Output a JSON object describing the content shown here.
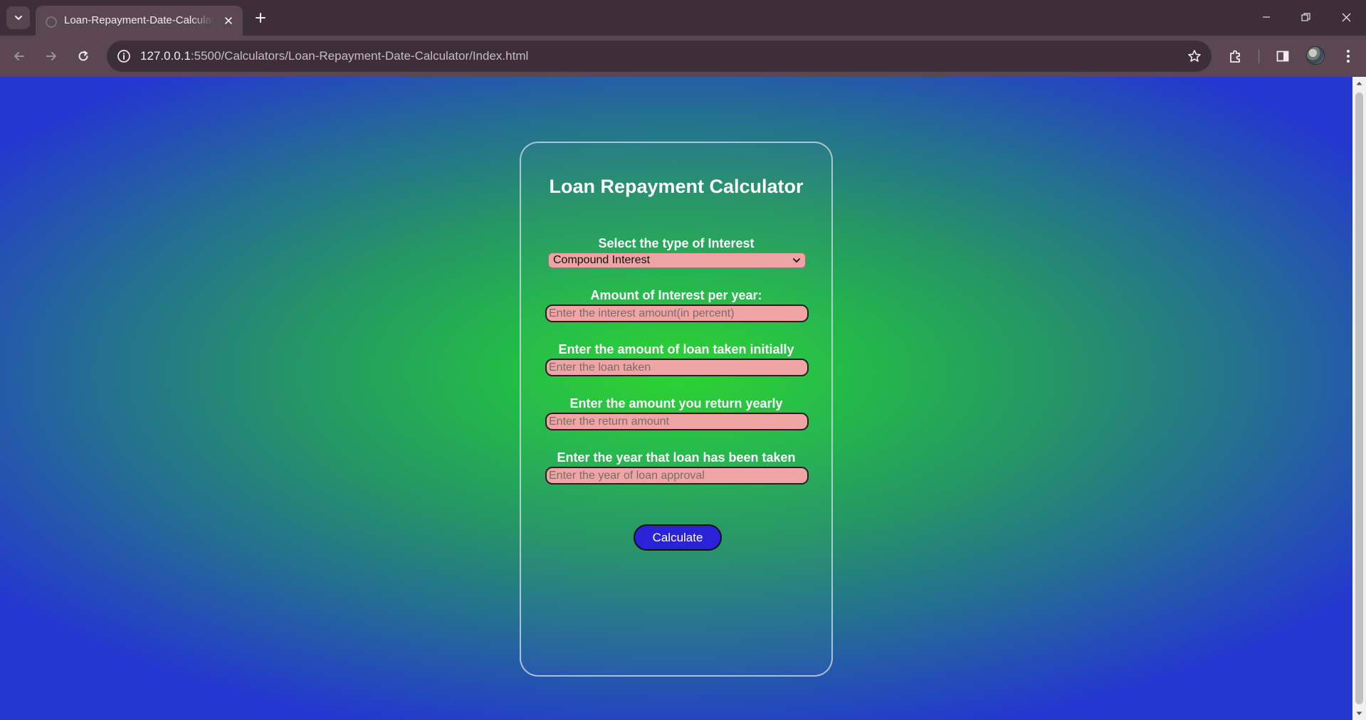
{
  "browser": {
    "tab": {
      "title": "Loan-Repayment-Date-Calculator"
    },
    "url": {
      "host": "127.0.0.1",
      "rest": ":5500/Calculators/Loan-Repayment-Date-Calculator/Index.html"
    }
  },
  "calculator": {
    "title": "Loan Repayment Calculator",
    "interest_type": {
      "label": "Select the type of Interest",
      "selected": "Compound Interest"
    },
    "interest_rate": {
      "label": "Amount of Interest per year:",
      "placeholder": "Enter the interest amount(in percent)"
    },
    "loan_amount": {
      "label": "Enter the amount of loan taken initially",
      "placeholder": "Enter the loan taken"
    },
    "yearly_return": {
      "label": "Enter the amount you return yearly",
      "placeholder": "Enter the return amount"
    },
    "loan_year": {
      "label": "Enter the year that loan has been taken",
      "placeholder": "Enter the year of loan approval"
    },
    "calculate_label": "Calculate"
  },
  "colors": {
    "field_fill": "#f1a4a4",
    "button_fill": "#2a22d8",
    "gradient_center": "#27d42e",
    "gradient_edge": "#2438cf"
  }
}
